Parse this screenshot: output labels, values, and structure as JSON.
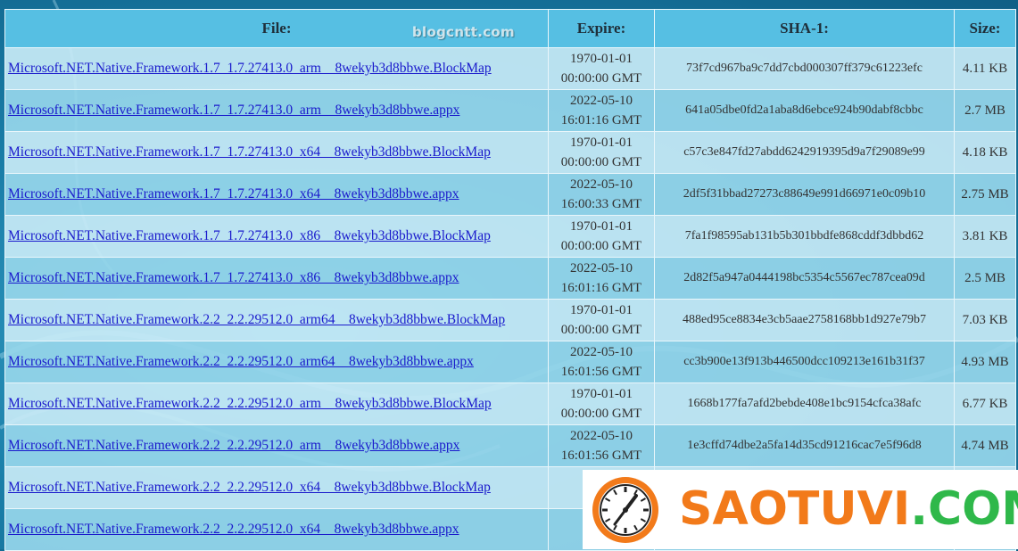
{
  "table": {
    "headers": {
      "file": "File:",
      "expire": "Expire:",
      "sha": "SHA-1:",
      "size": "Size:"
    },
    "rows": [
      {
        "file": "Microsoft.NET.Native.Framework.1.7_1.7.27413.0_arm__8wekyb3d8bbwe.BlockMap",
        "expire_date": "1970-01-01",
        "expire_time": "00:00:00 GMT",
        "sha": "73f7cd967ba9c7dd7cbd000307ff379c61223efc",
        "size": "4.11 KB"
      },
      {
        "file": "Microsoft.NET.Native.Framework.1.7_1.7.27413.0_arm__8wekyb3d8bbwe.appx",
        "expire_date": "2022-05-10",
        "expire_time": "16:01:16 GMT",
        "sha": "641a05dbe0fd2a1aba8d6ebce924b90dabf8cbbc",
        "size": "2.7 MB"
      },
      {
        "file": "Microsoft.NET.Native.Framework.1.7_1.7.27413.0_x64__8wekyb3d8bbwe.BlockMap",
        "expire_date": "1970-01-01",
        "expire_time": "00:00:00 GMT",
        "sha": "c57c3e847fd27abdd6242919395d9a7f29089e99",
        "size": "4.18 KB"
      },
      {
        "file": "Microsoft.NET.Native.Framework.1.7_1.7.27413.0_x64__8wekyb3d8bbwe.appx",
        "expire_date": "2022-05-10",
        "expire_time": "16:00:33 GMT",
        "sha": "2df5f31bbad27273c88649e991d66971e0c09b10",
        "size": "2.75 MB"
      },
      {
        "file": "Microsoft.NET.Native.Framework.1.7_1.7.27413.0_x86__8wekyb3d8bbwe.BlockMap",
        "expire_date": "1970-01-01",
        "expire_time": "00:00:00 GMT",
        "sha": "7fa1f98595ab131b5b301bbdfe868cddf3dbbd62",
        "size": "3.81 KB"
      },
      {
        "file": "Microsoft.NET.Native.Framework.1.7_1.7.27413.0_x86__8wekyb3d8bbwe.appx",
        "expire_date": "2022-05-10",
        "expire_time": "16:01:16 GMT",
        "sha": "2d82f5a947a0444198bc5354c5567ec787cea09d",
        "size": "2.5 MB"
      },
      {
        "file": "Microsoft.NET.Native.Framework.2.2_2.2.29512.0_arm64__8wekyb3d8bbwe.BlockMap",
        "expire_date": "1970-01-01",
        "expire_time": "00:00:00 GMT",
        "sha": "488ed95ce8834e3cb5aae2758168bb1d927e79b7",
        "size": "7.03 KB"
      },
      {
        "file": "Microsoft.NET.Native.Framework.2.2_2.2.29512.0_arm64__8wekyb3d8bbwe.appx",
        "expire_date": "2022-05-10",
        "expire_time": "16:01:56 GMT",
        "sha": "cc3b900e13f913b446500dcc109213e161b31f37",
        "size": "4.93 MB"
      },
      {
        "file": "Microsoft.NET.Native.Framework.2.2_2.2.29512.0_arm__8wekyb3d8bbwe.BlockMap",
        "expire_date": "1970-01-01",
        "expire_time": "00:00:00 GMT",
        "sha": "1668b177fa7afd2bebde408e1bc9154cfca38afc",
        "size": "6.77 KB"
      },
      {
        "file": "Microsoft.NET.Native.Framework.2.2_2.2.29512.0_arm__8wekyb3d8bbwe.appx",
        "expire_date": "2022-05-10",
        "expire_time": "16:01:56 GMT",
        "sha": "1e3cffd74dbe2a5fa14d35cd91216cac7e5f96d8",
        "size": "4.74 MB"
      },
      {
        "file": "Microsoft.NET.Native.Framework.2.2_2.2.29512.0_x64__8wekyb3d8bbwe.BlockMap",
        "expire_date": "19",
        "expire_time": "00",
        "sha": "",
        "size": ""
      },
      {
        "file": "Microsoft.NET.Native.Framework.2.2_2.2.29512.0_x64__8wekyb3d8bbwe.appx",
        "expire_date": "20",
        "expire_time": "16:0",
        "sha": "",
        "size": ""
      }
    ]
  },
  "watermark": {
    "blog": "blogcntt.com",
    "logo_part1": "SAOTUVI",
    "logo_part2": ".COM"
  },
  "colors": {
    "header_bg": "#56bfe3",
    "row_light": "#c8eaf6",
    "row_dark": "#96d6ea",
    "link": "#1a1acc",
    "logo_orange": "#f27a1a",
    "logo_green": "#2fb84a"
  }
}
